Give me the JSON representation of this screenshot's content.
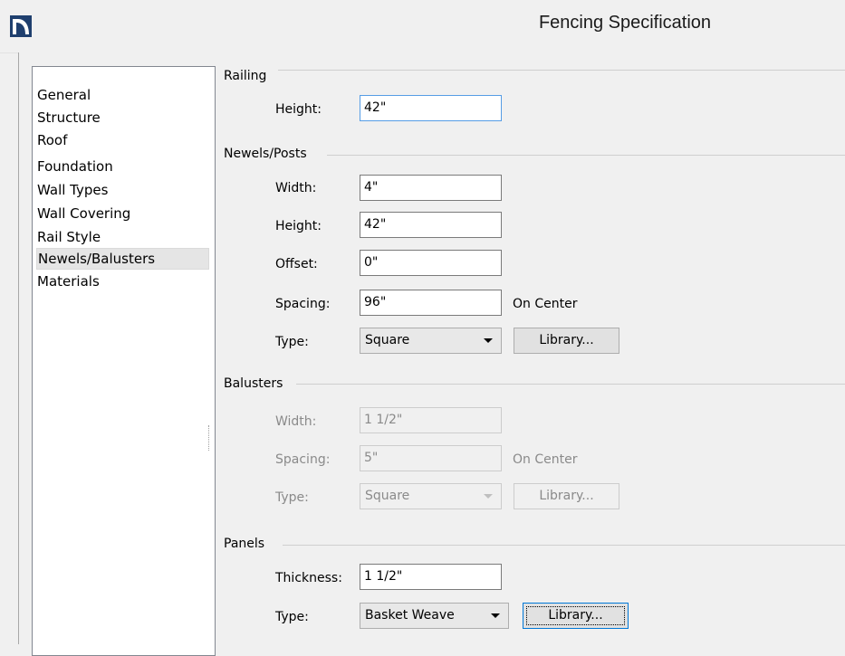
{
  "window": {
    "title": "Fencing Specification"
  },
  "nav": {
    "items": [
      "General",
      "Structure",
      "Roof",
      "Foundation",
      "Wall Types",
      "Wall Covering",
      "Rail Style",
      "Newels/Balusters",
      "Materials"
    ],
    "selected": "Newels/Balusters"
  },
  "railing": {
    "group": "Railing",
    "height_label": "Height:",
    "height_value": "42\""
  },
  "newels": {
    "group": "Newels/Posts",
    "width_label": "Width:",
    "width_value": "4\"",
    "height_label": "Height:",
    "height_value": "42\"",
    "offset_label": "Offset:",
    "offset_value": "0\"",
    "spacing_label": "Spacing:",
    "spacing_value": "96\"",
    "spacing_suffix": "On Center",
    "type_label": "Type:",
    "type_value": "Square",
    "library_label": "Library..."
  },
  "balusters": {
    "group": "Balusters",
    "width_label": "Width:",
    "width_value": "1 1/2\"",
    "spacing_label": "Spacing:",
    "spacing_value": "5\"",
    "spacing_suffix": "On Center",
    "type_label": "Type:",
    "type_value": "Square",
    "library_label": "Library..."
  },
  "panels": {
    "group": "Panels",
    "thickness_label": "Thickness:",
    "thickness_value": "1 1/2\"",
    "type_label": "Type:",
    "type_value": "Basket Weave",
    "library_label": "Library..."
  },
  "colors": {
    "accent_focus": "#569de5",
    "nav_selected": "#e5e5e5"
  },
  "icons": {
    "app": "app-logo-icon",
    "dropdown": "chevron-down-icon"
  }
}
